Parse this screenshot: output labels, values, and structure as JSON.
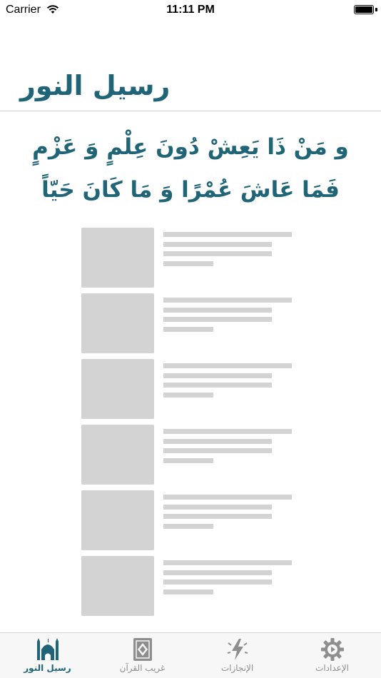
{
  "status_bar": {
    "carrier": "Carrier",
    "time": "11:11 PM",
    "battery_level": 1.0
  },
  "header": {
    "title": "رسيل النور"
  },
  "poem": {
    "line1": "و مَنْ ذَا يَعِشْ دُونَ عِلْمٍ وَ عَزْمٍ",
    "line2": "فَمَا عَاشَ عُمْرًا وَ مَا كَانَ حَيّاً"
  },
  "placeholders": {
    "row_count": 6
  },
  "tab_bar": {
    "selected_index": 0,
    "accent_color": "#1f6477",
    "inactive_color": "#8e8e8e",
    "tabs": [
      {
        "label": "رسيل النور",
        "icon": "mosque-icon"
      },
      {
        "label": "غريب القرآن",
        "icon": "quran-book-icon"
      },
      {
        "label": "الإنجازات",
        "icon": "lightning-icon"
      },
      {
        "label": "الإعدادات",
        "icon": "gear-icon"
      }
    ]
  }
}
